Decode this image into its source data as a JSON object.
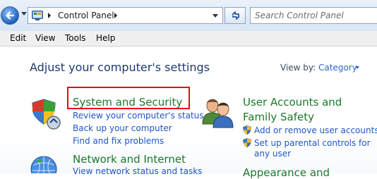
{
  "address_bar": {
    "breadcrumb": [
      "Control Panel"
    ],
    "search_placeholder": "Search Control Panel"
  },
  "menu": [
    "Edit",
    "View",
    "Tools",
    "Help"
  ],
  "main": {
    "heading": "Adjust your computer's settings",
    "view_by_label": "View by:",
    "view_by_value": "Category",
    "categories": [
      {
        "title": "System and Security",
        "links": [
          "Review your computer's status",
          "Back up your computer",
          "Find and fix problems"
        ]
      },
      {
        "title": "User Accounts and Family Safety",
        "title_lines": [
          "User Accounts and",
          "Family Safety"
        ],
        "links": [
          "Add or remove user accounts",
          "Set up parental controls for any user"
        ],
        "link_lines": [
          "Add or remove user accounts",
          "Set up parental controls for",
          "any user"
        ]
      },
      {
        "title": "Network and Internet",
        "links": [
          "View network status and tasks"
        ]
      },
      {
        "title": "Appearance and"
      }
    ]
  },
  "colors": {
    "category_title": "#1b7a2a",
    "link": "#1f55c8",
    "highlight": "#e30b17",
    "heading": "#1e3a6e"
  },
  "icons": [
    "back-forward-icon",
    "control-panel-icon",
    "refresh-icon",
    "search-icon",
    "system-security-icon",
    "users-icon",
    "network-icon",
    "uac-shield-icon"
  ]
}
